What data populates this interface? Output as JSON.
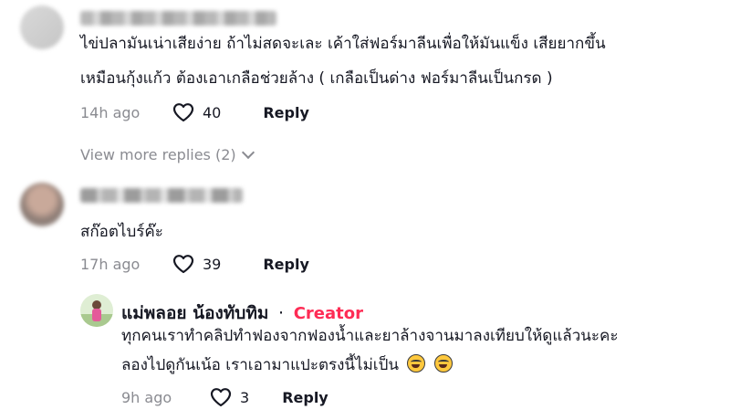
{
  "comments": [
    {
      "lines": [
        "ไข่ปลามันเน่าเสียง่าย ถ้าไม่สดจะเละ เค้าใส่ฟอร์มาลีนเพื่อให้มันแข็ง เสียยากขึ้น",
        "เหมือนกุ้งแก้ว ต้องเอาเกลือช่วยล้าง ( เกลือเป็นด่าง ฟอร์มาลีนเป็นกรด )"
      ],
      "time": "14h ago",
      "likes": "40",
      "reply": "Reply",
      "view_more": "View more replies (2)"
    },
    {
      "lines": [
        "สก๊อตไบร์ค๊ะ"
      ],
      "time": "17h ago",
      "likes": "39",
      "reply": "Reply"
    }
  ],
  "creator_reply": {
    "name": "แม่พลอย น้องทับทิม",
    "separator": "·",
    "tag": "Creator",
    "lines": [
      "ทุกคนเราทำคลิปทำฟองจากฟองน้ำและยาล้างจานมาลงเทียบให้ดูแล้วนะคะ",
      "ลองไปดูกันเน้อ เราเอามาแปะตรงนี้ไม่เป็น"
    ],
    "emojis": [
      "laughing-tears-emoji",
      "laughing-tears-emoji"
    ],
    "time": "9h ago",
    "likes": "3",
    "reply": "Reply"
  },
  "icons": {
    "like": "heart-outline-icon",
    "expand": "chevron-down-icon"
  }
}
